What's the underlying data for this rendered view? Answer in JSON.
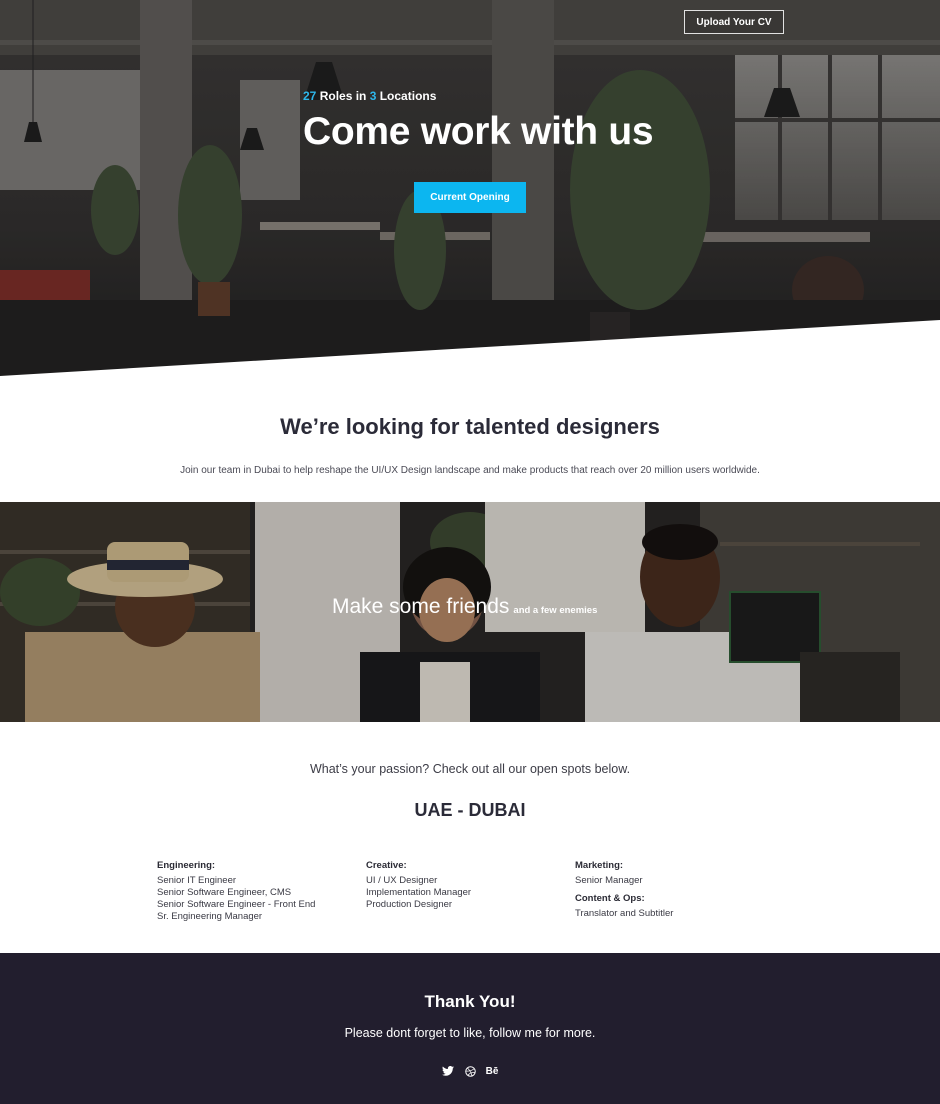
{
  "header": {
    "upload_label": "Upload Your CV"
  },
  "hero": {
    "roles_count": "27",
    "roles_text": " Roles in ",
    "locations_count": "3",
    "locations_text": " Locations",
    "title": "Come work with us",
    "cta_label": "Current Opening"
  },
  "intro": {
    "title": "We’re looking for talented designers",
    "text": "Join our team in Dubai to help reshape the UI/UX Design landscape and make products that reach over 20 million users worldwide."
  },
  "friends": {
    "title": "Make some friends",
    "subtitle": "and a few enemies"
  },
  "openings": {
    "passion_text": "What’s your passion? Check out all our open spots below.",
    "location": "UAE - DUBAI",
    "columns": [
      {
        "departments": [
          {
            "name": "Engineering:",
            "roles": [
              "Senior IT Engineer",
              "Senior Software Engineer, CMS",
              "Senior Software Engineer - Front End",
              "Sr. Engineering Manager"
            ]
          }
        ]
      },
      {
        "departments": [
          {
            "name": "Creative:",
            "roles": [
              "UI / UX Designer",
              "Implementation Manager",
              "Production Designer"
            ]
          }
        ]
      },
      {
        "departments": [
          {
            "name": "Marketing:",
            "roles": [
              "Senior Manager"
            ]
          },
          {
            "name": "Content & Ops:",
            "roles": [
              "Translator and Subtitler"
            ]
          }
        ]
      }
    ]
  },
  "footer": {
    "thanks": "Thank You!",
    "follow_text": "Please dont forget to like, follow me for more.",
    "social_icons": [
      "twitter-icon",
      "dribbble-icon",
      "behance-icon"
    ],
    "behance_glyph": "Bē"
  },
  "colors": {
    "accent": "#0cb6f0",
    "footer_bg": "#221e2e",
    "heading": "#2b2b38"
  }
}
